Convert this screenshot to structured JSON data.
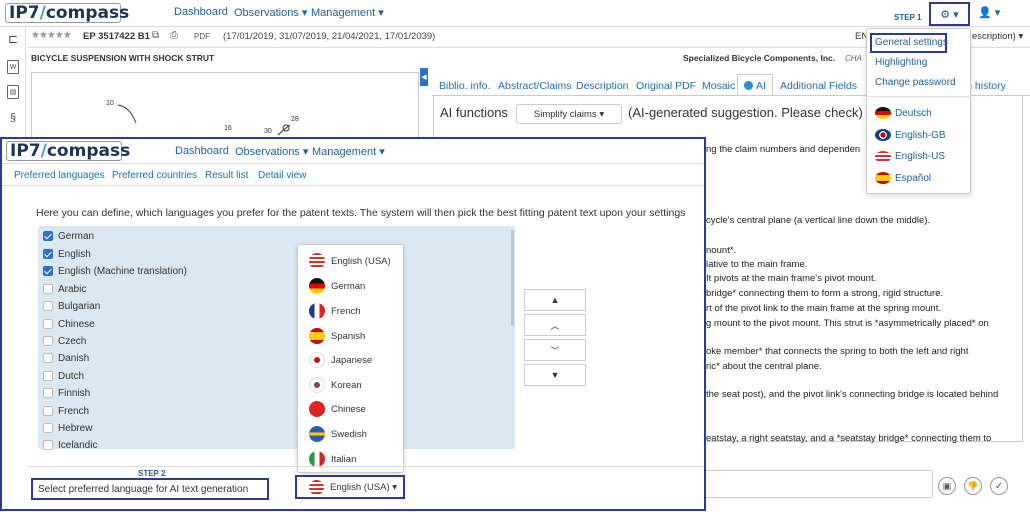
{
  "header": {
    "logo_prefix": "IP7",
    "logo_main": "compass",
    "nav": [
      "Dashboard",
      "Observations ▾",
      "Management ▾"
    ],
    "step1_label": "STEP 1",
    "settings_btn": "⚙ ▾",
    "user_btn": "👤 ▾"
  },
  "patent": {
    "stars": "★★★★★",
    "number": "EP 3517422 B1",
    "pdf": "PDF",
    "dates": "(17/01/2019, 31/07/2019, 21/04/2021, 17/01/2039)",
    "lang_code": "EN",
    "desc_sel": "escription) ▾",
    "title": "BICYCLE SUSPENSION WITH SHOCK STRUT",
    "applicant": "Specialized Bicycle Components, Inc.",
    "cha": "CHA"
  },
  "tabs": [
    "Biblio. info.",
    "Abstract/Claims",
    "Description",
    "Original PDF",
    "Mosaic",
    "AI",
    "Additional Fields",
    "ion history"
  ],
  "ai": {
    "functions_label": "AI functions",
    "select_value": "Simplify claims ▾",
    "suggestion": "(AI-generated suggestion. Please check)",
    "lines": [
      "ng the claim numbers and dependen",
      "cycle's central plane (a vertical line down the middle).",
      "nount*.",
      "lative to the main frame.",
      " It pivots at the main frame's pivot mount.",
      " bridge* connecting them to form a strong, rigid structure.",
      "rt of the pivot link to the main frame at the spring mount.",
      "g mount to the pivot mount. This strut is *asymmetrically placed* on",
      "oke member* that connects the spring to both the left and right",
      "ric* about the central plane.",
      " the seat post), and the pivot link's connecting bridge is located behind",
      "eatstay, a right seatstay, and a *seatstay bridge* connecting them to"
    ]
  },
  "settings_menu": {
    "items": [
      "General settings",
      "Highlighting",
      "Change password"
    ],
    "languages": [
      "Deutsch",
      "English-GB",
      "English-US",
      "Español"
    ]
  },
  "drawing_labels": [
    "10",
    "16",
    "30",
    "28"
  ],
  "overlay": {
    "nav": [
      "Dashboard",
      "Observations ▾",
      "Management ▾"
    ],
    "subtabs": [
      "Preferred languages",
      "Preferred countries",
      "Result list",
      "Detail view"
    ],
    "intro": "Here you can define, which languages you prefer for the patent texts. The system will then pick the best fitting patent text upon your settings",
    "languages": [
      {
        "label": "German",
        "checked": true
      },
      {
        "label": "English",
        "checked": true
      },
      {
        "label": "English (Machine translation)",
        "checked": true
      },
      {
        "label": "Arabic",
        "checked": false
      },
      {
        "label": "Bulgarian",
        "checked": false
      },
      {
        "label": "Chinese",
        "checked": false
      },
      {
        "label": "Czech",
        "checked": false
      },
      {
        "label": "Danish",
        "checked": false
      },
      {
        "label": "Dutch",
        "checked": false
      },
      {
        "label": "Finnish",
        "checked": false
      },
      {
        "label": "French",
        "checked": false
      },
      {
        "label": "Hebrew",
        "checked": false
      },
      {
        "label": "Icelandic",
        "checked": false
      }
    ],
    "ai_options": [
      "English (USA)",
      "German",
      "French",
      "Spanish",
      "Japanese",
      "Korean",
      "Chinese",
      "Swedish",
      "Italian"
    ],
    "selected_ai_language": "English (USA) ▾",
    "step2_label": "STEP 2",
    "step2_text": "Select preferred language for AI text generation",
    "move_buttons": [
      "▲",
      "︿",
      "﹀",
      "▼"
    ]
  }
}
